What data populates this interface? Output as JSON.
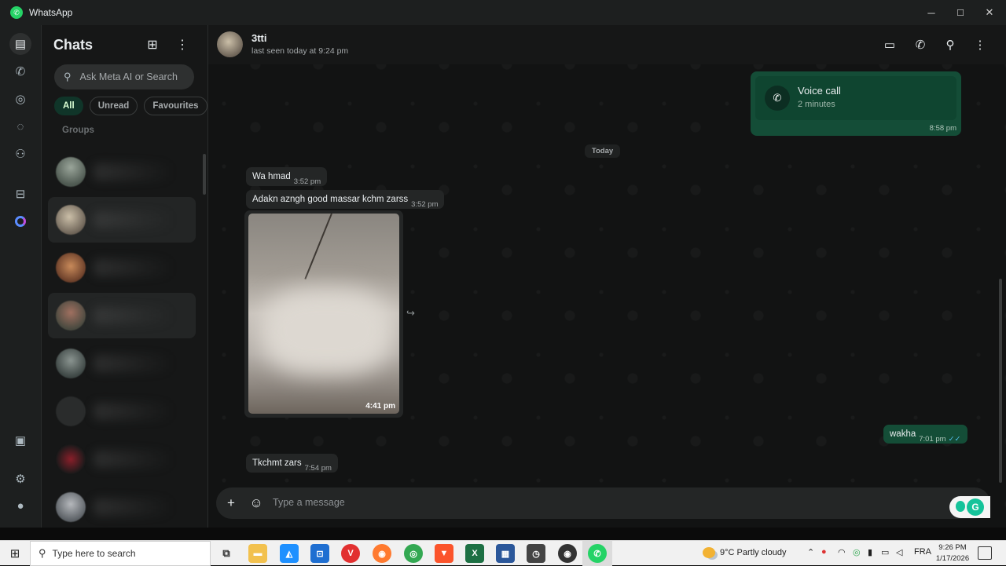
{
  "app": {
    "title": "WhatsApp"
  },
  "window_controls": {
    "minimize": "─",
    "maximize": "☐",
    "close": "✕"
  },
  "sidebar": {
    "title": "Chats",
    "search_placeholder": "Ask Meta AI or Search",
    "filters": [
      "All",
      "Unread",
      "Favourites"
    ],
    "active_filter": "All",
    "section_label": "Groups"
  },
  "conversation": {
    "contact_name": "3tti",
    "status": "last seen today at 9:24 pm",
    "call_card": {
      "title": "Voice call",
      "duration": "2 minutes",
      "time": "8:58 pm"
    },
    "date_separator": "Today",
    "messages": [
      {
        "text": "Wa hmad",
        "time": "3:52 pm"
      },
      {
        "text": "Adakn azngh good massar kchm zarss",
        "time": "3:52 pm"
      },
      {
        "media_time": "4:41 pm"
      },
      {
        "text": "wakha",
        "time": "7:01 pm",
        "ticks": "✓✓"
      },
      {
        "text": "Tkchmt zars",
        "time": "7:54 pm"
      }
    ],
    "composer_placeholder": "Type a message"
  },
  "taskbar": {
    "search_placeholder": "Type here to search",
    "weather": "9°C  Partly cloudy",
    "language": "FRA",
    "time": "9:26 PM",
    "date": "1/17/2026"
  },
  "colors": {
    "accent": "#25d366",
    "outgoing_bubble": "#144d37",
    "incoming_bubble": "#242626",
    "chat_background": "#121313"
  }
}
